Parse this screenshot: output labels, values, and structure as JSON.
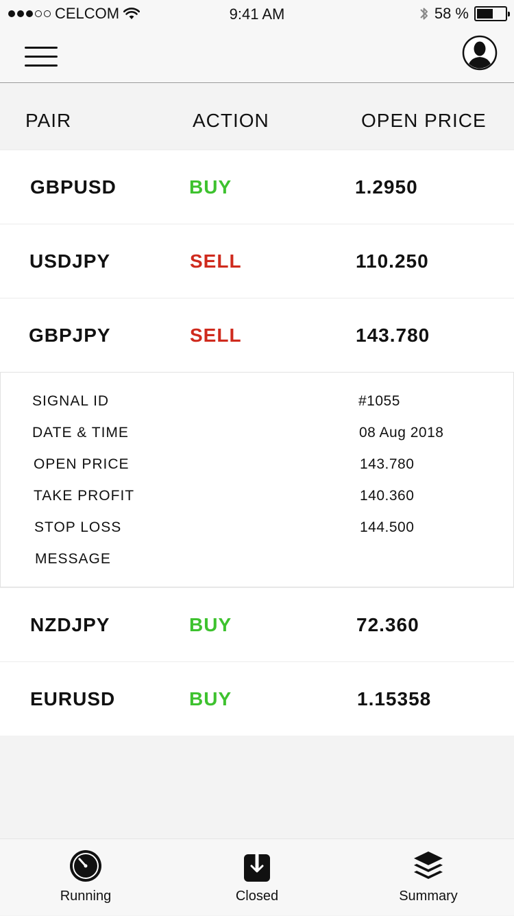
{
  "status_bar": {
    "carrier": "CELCOM",
    "time": "9:41 AM",
    "battery_percent": "58 %",
    "battery_level": 0.58,
    "signal_bars_filled": 3,
    "signal_bars_total": 5
  },
  "nav": {
    "menu_icon": "hamburger-menu-icon",
    "profile_icon": "user-profile-icon"
  },
  "table": {
    "headers": {
      "pair": "PAIR",
      "action": "ACTION",
      "open_price": "OPEN PRICE"
    },
    "rows": [
      {
        "pair": "GBPUSD",
        "action": "BUY",
        "open_price": "1.2950"
      },
      {
        "pair": "USDJPY",
        "action": "SELL",
        "open_price": "110.250"
      },
      {
        "pair": "GBPJPY",
        "action": "SELL",
        "open_price": "143.780"
      },
      {
        "pair": "NZDJPY",
        "action": "BUY",
        "open_price": "72.360"
      },
      {
        "pair": "EURUSD",
        "action": "BUY",
        "open_price": "1.15358"
      }
    ],
    "colors": {
      "buy": "#3ec22f",
      "sell": "#cf2a1d"
    }
  },
  "details": {
    "signal_id_label": "SIGNAL ID",
    "signal_id": "#1055",
    "datetime_label": "DATE & TIME",
    "datetime": "08 Aug 2018",
    "open_price_label": "OPEN PRICE",
    "open_price": "143.780",
    "take_profit_label": "TAKE PROFIT",
    "take_profit": "140.360",
    "stop_loss_label": "STOP LOSS",
    "stop_loss": "144.500",
    "message_label": "MESSAGE",
    "message": ""
  },
  "tabs": [
    {
      "label": "Running",
      "icon": "stopwatch-icon"
    },
    {
      "label": "Closed",
      "icon": "download-box-icon"
    },
    {
      "label": "Summary",
      "icon": "layers-icon"
    }
  ]
}
